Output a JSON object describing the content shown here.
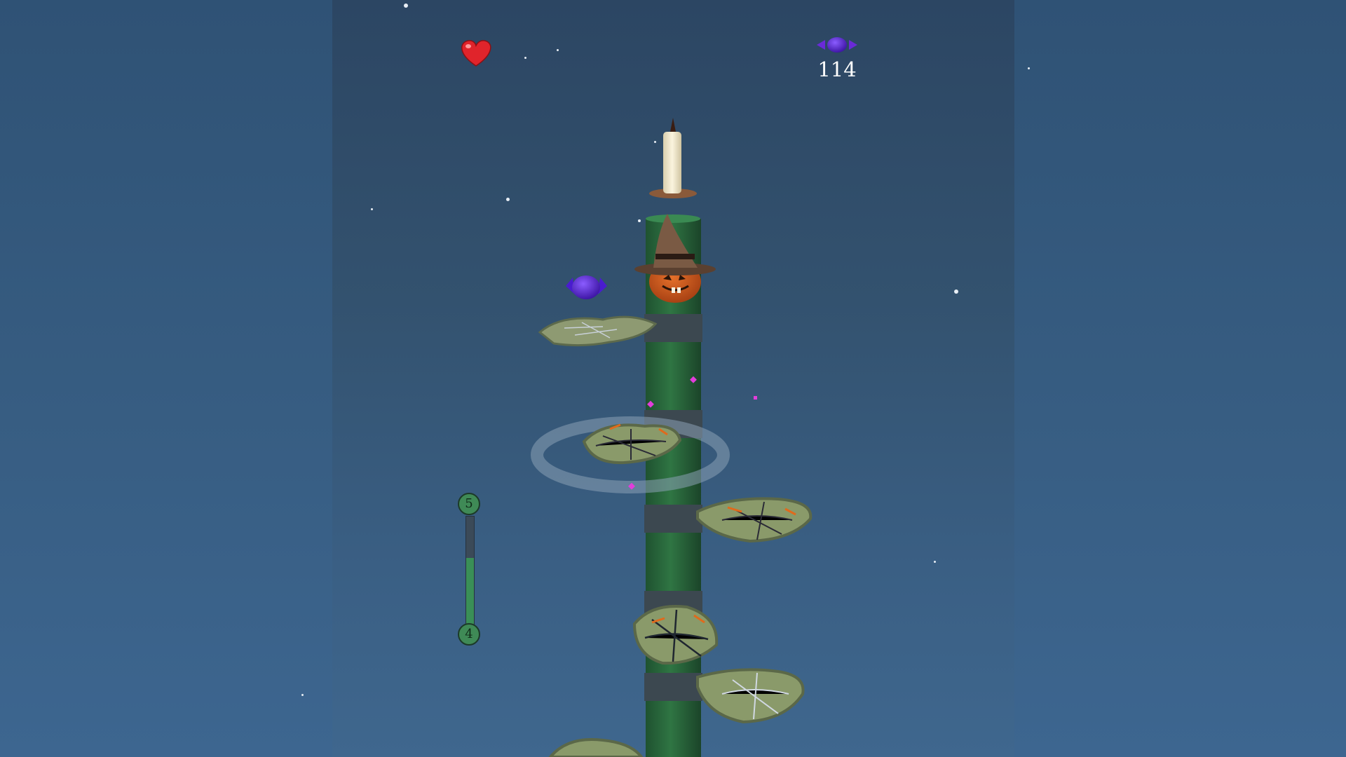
{
  "hud": {
    "lives_icon": "heart-icon",
    "candy_icon": "wrapped-candy-icon",
    "candy_count": "114"
  },
  "level_progress": {
    "current_level": "4",
    "next_level": "5",
    "progress": 0.62
  },
  "scene": {
    "tower": "green-pillar",
    "player": "pumpkin-with-witch-hat",
    "goal": "candle",
    "platforms": "spiderweb-ledges",
    "pickup": "wrapped-candy-icon"
  },
  "colors": {
    "tower": "#2e6b3d",
    "tower_band": "#3e4a52",
    "candy": "#5a22c8",
    "heart": "#e0242b",
    "progress_fill": "#3a8f57"
  }
}
